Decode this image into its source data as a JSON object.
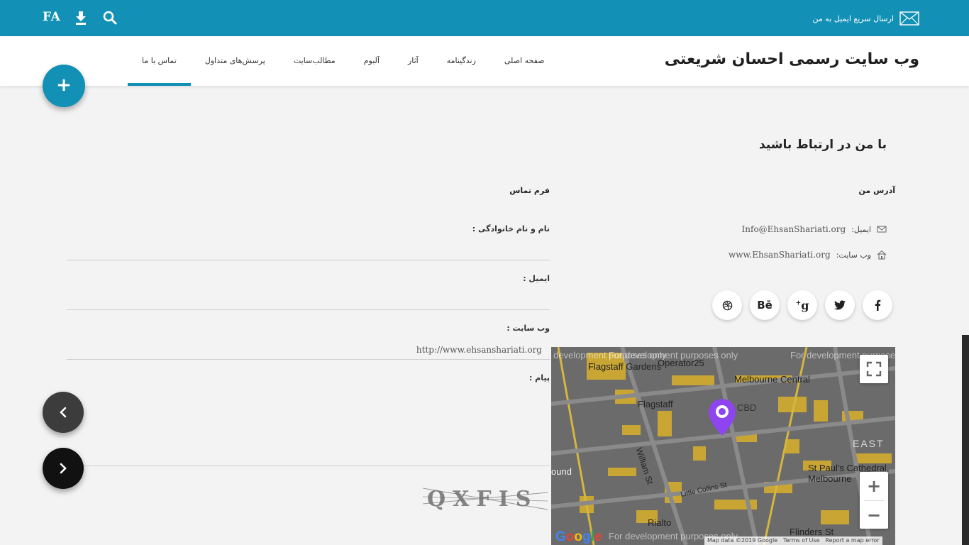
{
  "topbar": {
    "lang": "FA",
    "quick_mail": "ارسال سریع ایمیل به من"
  },
  "header": {
    "site_title": "وب سایت رسمی احسان شریعتی",
    "nav": [
      "صفحه اصلی",
      "زندگینامه",
      "آثار",
      "آلبوم",
      "مطالب‌سایت",
      "پرسش‌های متداول",
      "تماس با ما"
    ],
    "active_index": 6
  },
  "contact": {
    "section_title": "با من در ارتباط باشید",
    "address_title": "آدرس من",
    "email_label": "ایمیل:",
    "email_value": "Info@EhsanShariati.org",
    "website_label": "وب سایت:",
    "website_value": "www.EhsanShariati.org"
  },
  "social": [
    "f",
    "twitter",
    "g+",
    "Bē",
    "dribbble"
  ],
  "form": {
    "title": "فرم تماس",
    "name_label": "نام و نام خانوادگی :",
    "email_label": "ایمیل :",
    "website_label": "وب سایت :",
    "website_value": "http://www.ehsanshariati.org",
    "message_label": "پیام :",
    "captcha_text": "QXFIS"
  },
  "map": {
    "dev_text": "For development purposes only",
    "streets": {
      "flagstaff_gardens": "Flagstaff Gardens",
      "operator25": "Operator25",
      "melbourne_central": "Melbourne Central",
      "flagstaff": "Flagstaff",
      "william_st": "William St",
      "cbd": "CBD",
      "east": "EAST",
      "st_pauls": "St Paul's Cathedral,",
      "melbourne": "Melbourne",
      "little_collins": "Little Collins St",
      "rialto": "Rialto",
      "flinders": "Flinders St",
      "ound": "ound"
    },
    "footer": [
      "Map data ©2019 Google",
      "Terms of Use",
      "Report a map error"
    ],
    "brand": "Google"
  },
  "colors": {
    "accent": "#1290b5",
    "map_bg": "#6b6b6b",
    "map_block": "#c9a634",
    "marker": "#8e44ef"
  }
}
